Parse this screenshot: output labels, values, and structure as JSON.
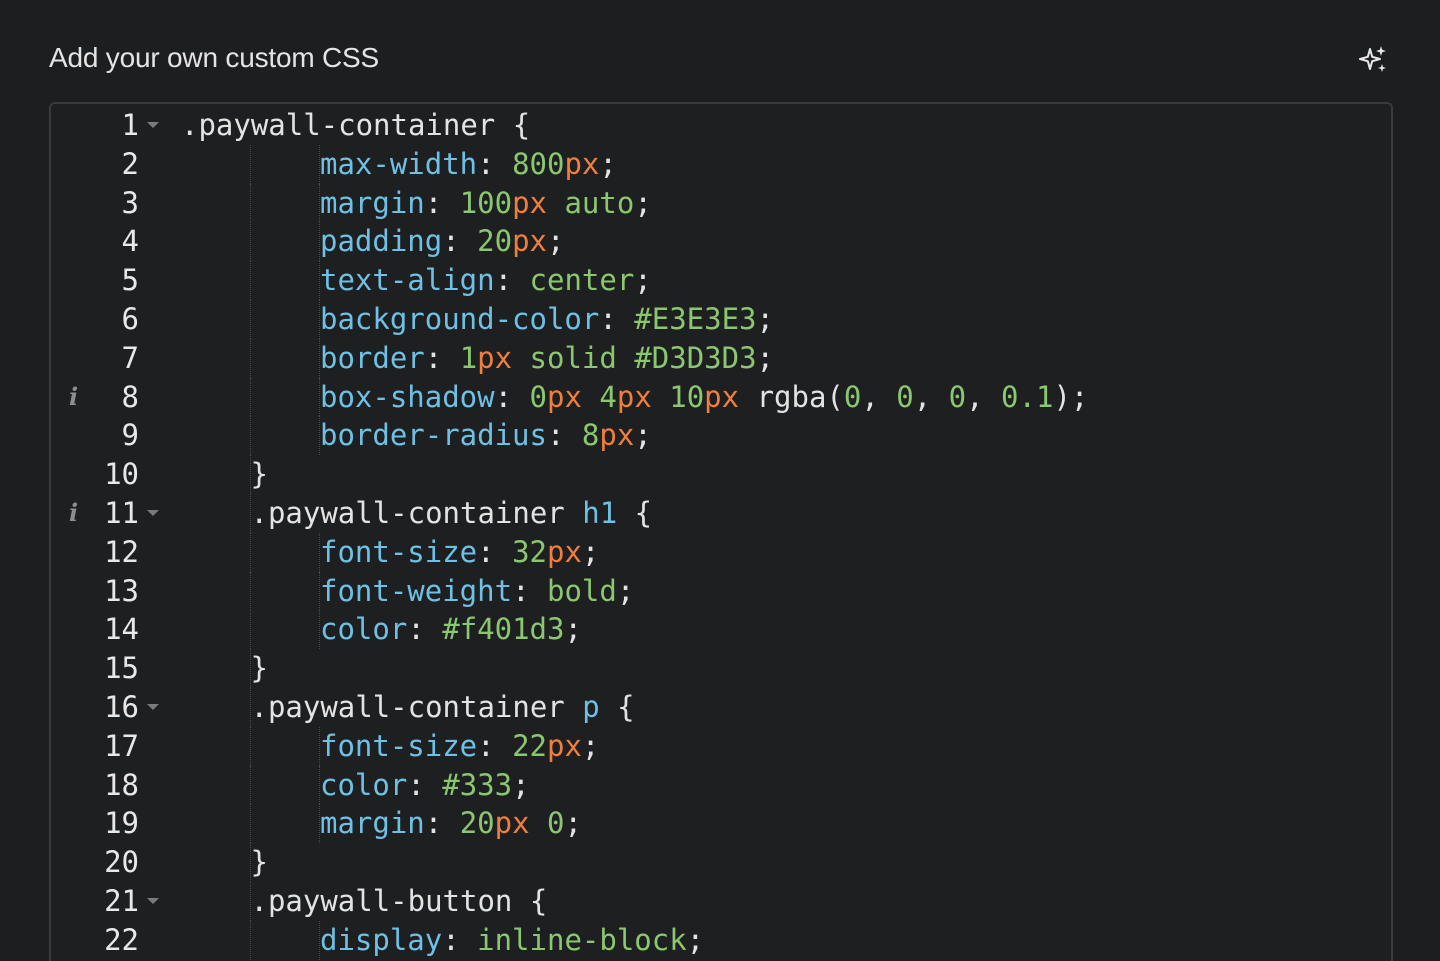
{
  "panel": {
    "title": "Add your own custom CSS",
    "ai_icon": "sparkle-icon"
  },
  "editor": {
    "language": "css",
    "lines": [
      {
        "n": "1",
        "fold": true,
        "info": false,
        "indent": 0,
        "tokens": [
          [
            "sel",
            ".paywall-container "
          ],
          [
            "punc",
            "{"
          ]
        ]
      },
      {
        "n": "2",
        "fold": false,
        "info": false,
        "indent": 2,
        "tokens": [
          [
            "prop",
            "max-width"
          ],
          [
            "punc",
            ": "
          ],
          [
            "val",
            "800"
          ],
          [
            "unit",
            "px"
          ],
          [
            "punc",
            ";"
          ]
        ]
      },
      {
        "n": "3",
        "fold": false,
        "info": false,
        "indent": 2,
        "tokens": [
          [
            "prop",
            "margin"
          ],
          [
            "punc",
            ": "
          ],
          [
            "val",
            "100"
          ],
          [
            "unit",
            "px"
          ],
          [
            "punc",
            " "
          ],
          [
            "val",
            "auto"
          ],
          [
            "punc",
            ";"
          ]
        ]
      },
      {
        "n": "4",
        "fold": false,
        "info": false,
        "indent": 2,
        "tokens": [
          [
            "prop",
            "padding"
          ],
          [
            "punc",
            ": "
          ],
          [
            "val",
            "20"
          ],
          [
            "unit",
            "px"
          ],
          [
            "punc",
            ";"
          ]
        ]
      },
      {
        "n": "5",
        "fold": false,
        "info": false,
        "indent": 2,
        "tokens": [
          [
            "prop",
            "text-align"
          ],
          [
            "punc",
            ": "
          ],
          [
            "val",
            "center"
          ],
          [
            "punc",
            ";"
          ]
        ]
      },
      {
        "n": "6",
        "fold": false,
        "info": false,
        "indent": 2,
        "tokens": [
          [
            "prop",
            "background-color"
          ],
          [
            "punc",
            ": "
          ],
          [
            "val",
            "#E3E3E3"
          ],
          [
            "punc",
            ";"
          ]
        ]
      },
      {
        "n": "7",
        "fold": false,
        "info": false,
        "indent": 2,
        "tokens": [
          [
            "prop",
            "border"
          ],
          [
            "punc",
            ": "
          ],
          [
            "val",
            "1"
          ],
          [
            "unit",
            "px"
          ],
          [
            "punc",
            " "
          ],
          [
            "val",
            "solid"
          ],
          [
            "punc",
            " "
          ],
          [
            "val",
            "#D3D3D3"
          ],
          [
            "punc",
            ";"
          ]
        ]
      },
      {
        "n": "8",
        "fold": false,
        "info": true,
        "indent": 2,
        "tokens": [
          [
            "prop",
            "box-shadow"
          ],
          [
            "punc",
            ": "
          ],
          [
            "val",
            "0"
          ],
          [
            "unit",
            "px"
          ],
          [
            "punc",
            " "
          ],
          [
            "val",
            "4"
          ],
          [
            "unit",
            "px"
          ],
          [
            "punc",
            " "
          ],
          [
            "val",
            "10"
          ],
          [
            "unit",
            "px"
          ],
          [
            "punc",
            " "
          ],
          [
            "fn",
            "rgba("
          ],
          [
            "val",
            "0"
          ],
          [
            "punc",
            ", "
          ],
          [
            "val",
            "0"
          ],
          [
            "punc",
            ", "
          ],
          [
            "val",
            "0"
          ],
          [
            "punc",
            ", "
          ],
          [
            "val",
            "0.1"
          ],
          [
            "punc",
            ");"
          ]
        ]
      },
      {
        "n": "9",
        "fold": false,
        "info": false,
        "indent": 2,
        "tokens": [
          [
            "prop",
            "border-radius"
          ],
          [
            "punc",
            ": "
          ],
          [
            "val",
            "8"
          ],
          [
            "unit",
            "px"
          ],
          [
            "punc",
            ";"
          ]
        ]
      },
      {
        "n": "10",
        "fold": false,
        "info": false,
        "indent": 1,
        "tokens": [
          [
            "punc",
            "}"
          ]
        ]
      },
      {
        "n": "11",
        "fold": true,
        "info": true,
        "indent": 1,
        "tokens": [
          [
            "sel",
            ".paywall-container "
          ],
          [
            "tag",
            "h1"
          ],
          [
            "punc",
            " {"
          ]
        ]
      },
      {
        "n": "12",
        "fold": false,
        "info": false,
        "indent": 2,
        "tokens": [
          [
            "prop",
            "font-size"
          ],
          [
            "punc",
            ": "
          ],
          [
            "val",
            "32"
          ],
          [
            "unit",
            "px"
          ],
          [
            "punc",
            ";"
          ]
        ]
      },
      {
        "n": "13",
        "fold": false,
        "info": false,
        "indent": 2,
        "tokens": [
          [
            "prop",
            "font-weight"
          ],
          [
            "punc",
            ": "
          ],
          [
            "val",
            "bold"
          ],
          [
            "punc",
            ";"
          ]
        ]
      },
      {
        "n": "14",
        "fold": false,
        "info": false,
        "indent": 2,
        "tokens": [
          [
            "prop",
            "color"
          ],
          [
            "punc",
            ": "
          ],
          [
            "val",
            "#f401d3"
          ],
          [
            "punc",
            ";"
          ]
        ]
      },
      {
        "n": "15",
        "fold": false,
        "info": false,
        "indent": 1,
        "tokens": [
          [
            "punc",
            "}"
          ]
        ]
      },
      {
        "n": "16",
        "fold": true,
        "info": false,
        "indent": 1,
        "tokens": [
          [
            "sel",
            ".paywall-container "
          ],
          [
            "tag",
            "p"
          ],
          [
            "punc",
            " {"
          ]
        ]
      },
      {
        "n": "17",
        "fold": false,
        "info": false,
        "indent": 2,
        "tokens": [
          [
            "prop",
            "font-size"
          ],
          [
            "punc",
            ": "
          ],
          [
            "val",
            "22"
          ],
          [
            "unit",
            "px"
          ],
          [
            "punc",
            ";"
          ]
        ]
      },
      {
        "n": "18",
        "fold": false,
        "info": false,
        "indent": 2,
        "tokens": [
          [
            "prop",
            "color"
          ],
          [
            "punc",
            ": "
          ],
          [
            "val",
            "#333"
          ],
          [
            "punc",
            ";"
          ]
        ]
      },
      {
        "n": "19",
        "fold": false,
        "info": false,
        "indent": 2,
        "tokens": [
          [
            "prop",
            "margin"
          ],
          [
            "punc",
            ": "
          ],
          [
            "val",
            "20"
          ],
          [
            "unit",
            "px"
          ],
          [
            "punc",
            " "
          ],
          [
            "val",
            "0"
          ],
          [
            "punc",
            ";"
          ]
        ]
      },
      {
        "n": "20",
        "fold": false,
        "info": false,
        "indent": 1,
        "tokens": [
          [
            "punc",
            "}"
          ]
        ]
      },
      {
        "n": "21",
        "fold": true,
        "info": false,
        "indent": 1,
        "tokens": [
          [
            "sel",
            ".paywall-button "
          ],
          [
            "punc",
            "{"
          ]
        ]
      },
      {
        "n": "22",
        "fold": false,
        "info": false,
        "indent": 2,
        "tokens": [
          [
            "prop",
            "display"
          ],
          [
            "punc",
            ": "
          ],
          [
            "val",
            "inline-block"
          ],
          [
            "punc",
            ";"
          ]
        ]
      }
    ]
  },
  "colors": {
    "background": "#1d1e20",
    "property": "#6ec1e4",
    "value": "#8bc76f",
    "unit": "#f07f3c",
    "text": "#e3e3e3"
  }
}
